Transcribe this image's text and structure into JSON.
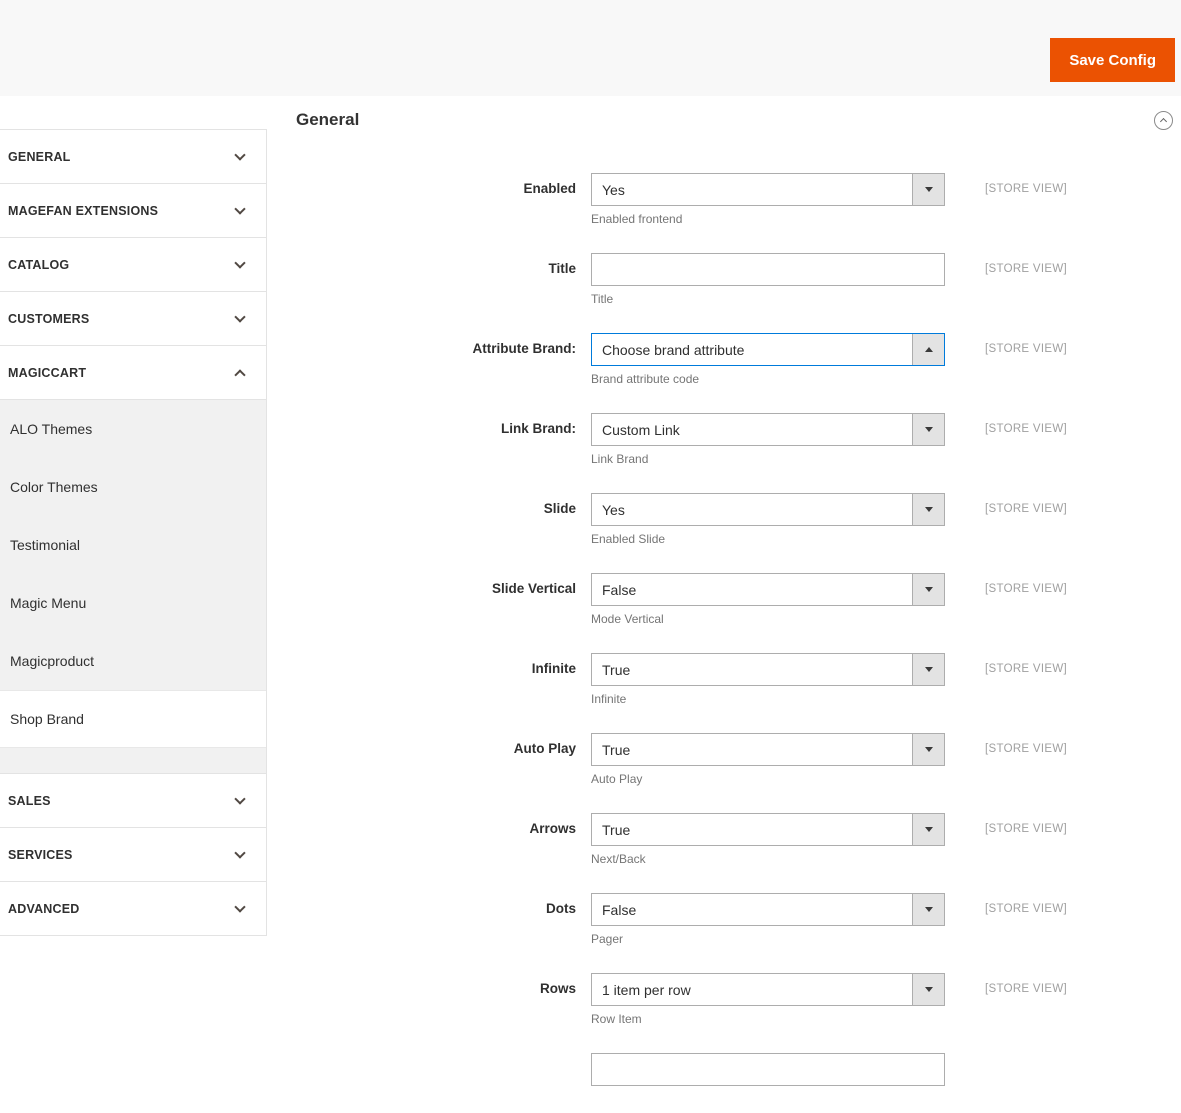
{
  "header": {
    "save_button_label": "Save Config"
  },
  "sidebar": {
    "sections": [
      {
        "label": "GENERAL",
        "expanded": false
      },
      {
        "label": "MAGEFAN EXTENSIONS",
        "expanded": false
      },
      {
        "label": "CATALOG",
        "expanded": false
      },
      {
        "label": "CUSTOMERS",
        "expanded": false
      },
      {
        "label": "MAGICCART",
        "expanded": true,
        "selected": "Shop Brand",
        "items": [
          "ALO Themes",
          "Color Themes",
          "Testimonial",
          "Magic Menu",
          "Magicproduct",
          "Shop Brand"
        ]
      },
      {
        "label": "SALES",
        "expanded": false
      },
      {
        "label": "SERVICES",
        "expanded": false
      },
      {
        "label": "ADVANCED",
        "expanded": false
      }
    ]
  },
  "main": {
    "section_title": "General",
    "fields": [
      {
        "label": "Enabled",
        "type": "select",
        "value": "Yes",
        "comment": "Enabled frontend",
        "scope": "[STORE VIEW]"
      },
      {
        "label": "Title",
        "type": "text",
        "value": "",
        "comment": "Title",
        "scope": "[STORE VIEW]"
      },
      {
        "label": "Attribute Brand:",
        "type": "select",
        "value": "Choose brand attribute",
        "comment": "Brand attribute code",
        "scope": "[STORE VIEW]",
        "focused": true,
        "open": true
      },
      {
        "label": "Link Brand:",
        "type": "select",
        "value": "Custom Link",
        "comment": "Link Brand",
        "scope": "[STORE VIEW]"
      },
      {
        "label": "Slide",
        "type": "select",
        "value": "Yes",
        "comment": "Enabled Slide",
        "scope": "[STORE VIEW]"
      },
      {
        "label": "Slide Vertical",
        "type": "select",
        "value": "False",
        "comment": "Mode Vertical",
        "scope": "[STORE VIEW]"
      },
      {
        "label": "Infinite",
        "type": "select",
        "value": "True",
        "comment": "Infinite",
        "scope": "[STORE VIEW]"
      },
      {
        "label": "Auto Play",
        "type": "select",
        "value": "True",
        "comment": "Auto Play",
        "scope": "[STORE VIEW]"
      },
      {
        "label": "Arrows",
        "type": "select",
        "value": "True",
        "comment": "Next/Back",
        "scope": "[STORE VIEW]"
      },
      {
        "label": "Dots",
        "type": "select",
        "value": "False",
        "comment": "Pager",
        "scope": "[STORE VIEW]"
      },
      {
        "label": "Rows",
        "type": "select",
        "value": "1 item per row",
        "comment": "Row Item",
        "scope": "[STORE VIEW]"
      },
      {
        "label": "",
        "type": "text",
        "value": "",
        "comment": "",
        "scope": "",
        "partial": true
      }
    ],
    "colors": {
      "accent": "#eb5202",
      "focus_border": "#007bdb"
    }
  }
}
